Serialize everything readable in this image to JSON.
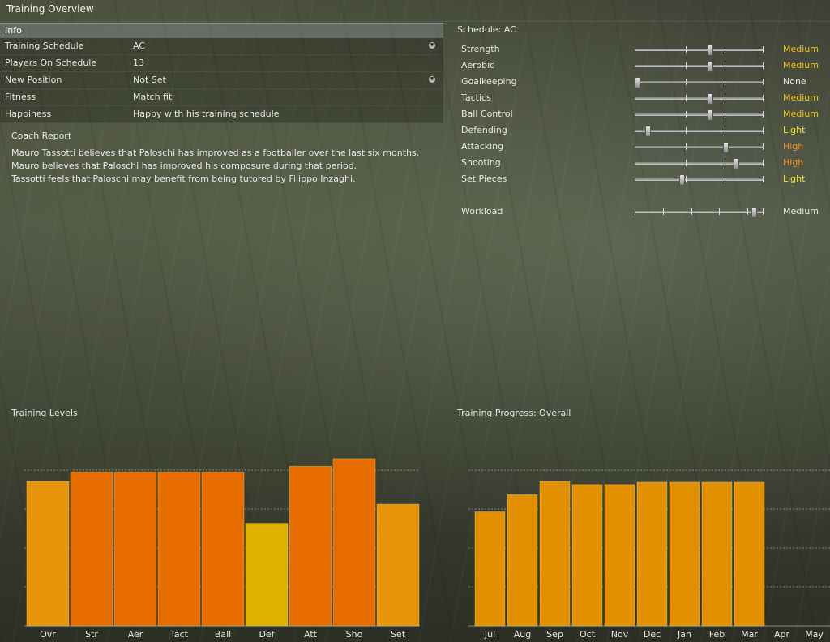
{
  "window": {
    "title": "Training Overview"
  },
  "info": {
    "header": "Info",
    "rows": [
      {
        "label": "Training Schedule",
        "value": "AC",
        "dropdown": true
      },
      {
        "label": "Players On Schedule",
        "value": "13",
        "dropdown": false
      },
      {
        "label": "New Position",
        "value": "Not Set",
        "dropdown": true
      },
      {
        "label": "Fitness",
        "value": "Match fit",
        "dropdown": false
      },
      {
        "label": "Happiness",
        "value": "Happy with his training schedule",
        "dropdown": false
      }
    ]
  },
  "coach_report": {
    "title": "Coach Report",
    "lines": [
      "Mauro Tassotti believes that Paloschi has improved as a footballer over the last six months.",
      "Mauro believes that Paloschi has improved his composure during that period.",
      "Tassotti feels that Paloschi may benefit from being tutored by Filippo Inzaghi."
    ]
  },
  "schedule": {
    "title": "Schedule: AC",
    "skills": [
      {
        "name": "Strength",
        "level": "Medium",
        "value": 0.57,
        "color": "#f0c020"
      },
      {
        "name": "Aerobic",
        "level": "Medium",
        "value": 0.57,
        "color": "#f0c020"
      },
      {
        "name": "Goalkeeping",
        "level": "None",
        "value": 0.0,
        "color": "#e6e6e6"
      },
      {
        "name": "Tactics",
        "level": "Medium",
        "value": 0.57,
        "color": "#f0c020"
      },
      {
        "name": "Ball Control",
        "level": "Medium",
        "value": 0.57,
        "color": "#f0c020"
      },
      {
        "name": "Defending",
        "level": "Light",
        "value": 0.08,
        "color": "#f0e040"
      },
      {
        "name": "Attacking",
        "level": "High",
        "value": 0.69,
        "color": "#f09020"
      },
      {
        "name": "Shooting",
        "level": "High",
        "value": 0.77,
        "color": "#f09020"
      },
      {
        "name": "Set Pieces",
        "level": "Light",
        "value": 0.35,
        "color": "#f0e040"
      }
    ],
    "workload": {
      "name": "Workload",
      "level": "Medium",
      "value": 0.91,
      "color": "#e6e6e6"
    }
  },
  "chart_data": [
    {
      "type": "bar",
      "title": "Training Levels",
      "categories": [
        "Ovr",
        "Str",
        "Aer",
        "Tact",
        "Ball",
        "Def",
        "Att",
        "Sho",
        "Set"
      ],
      "values": [
        3.8,
        4.05,
        4.05,
        4.05,
        4.05,
        2.7,
        4.2,
        4.4,
        3.2
      ],
      "colors": [
        "#e8940a",
        "#e66c00",
        "#e66c00",
        "#e66c00",
        "#e66c00",
        "#e0b000",
        "#e66c00",
        "#e66c00",
        "#e8940a"
      ],
      "ylim": [
        0,
        4.1
      ],
      "grid": true
    },
    {
      "type": "bar",
      "title": "Training Progress: Overall",
      "categories": [
        "Jul",
        "Aug",
        "Sep",
        "Oct",
        "Nov",
        "Dec",
        "Jan",
        "Feb",
        "Mar",
        "Apr",
        "May"
      ],
      "values": [
        3.0,
        3.45,
        3.8,
        3.72,
        3.72,
        3.78,
        3.78,
        3.78,
        3.78,
        null,
        null
      ],
      "ylim": [
        0,
        4.1
      ],
      "grid": true,
      "bar_color": "#e39000"
    }
  ]
}
